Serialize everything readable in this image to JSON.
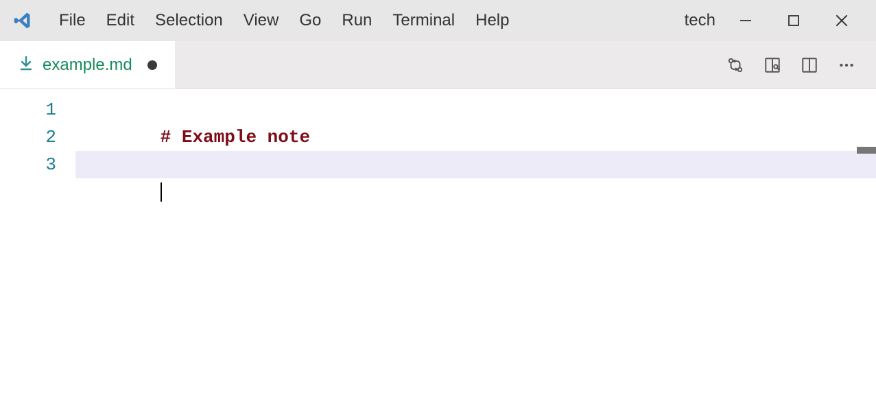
{
  "menu": {
    "items": [
      "File",
      "Edit",
      "Selection",
      "View",
      "Go",
      "Run",
      "Terminal",
      "Help"
    ]
  },
  "title_right": "tech",
  "tab": {
    "filename": "example.md",
    "dirty": true
  },
  "editor": {
    "lines": [
      {
        "num": "1",
        "kind": "md-h1",
        "hash": "#",
        "text": " Example note"
      },
      {
        "num": "2",
        "kind": "empty",
        "text": ""
      },
      {
        "num": "3",
        "kind": "cursor",
        "text": ""
      }
    ],
    "active_line_index": 2
  },
  "icons": {
    "app": "vscode-icon",
    "tab_file": "arrow-down-icon",
    "compare": "compare-changes-icon",
    "preview": "open-preview-icon",
    "split": "split-editor-icon",
    "more": "more-icon",
    "minimize": "minimize-icon",
    "maximize": "maximize-icon",
    "close": "close-icon"
  },
  "colors": {
    "titlebar": "#e7e7e7",
    "tabbar": "#eceaea",
    "tab_active": "#ffffff",
    "tab_text": "#178a5b",
    "line_number": "#1a7e93",
    "md_heading": "#7e0c16",
    "active_line_bg": "#ecebf7"
  }
}
